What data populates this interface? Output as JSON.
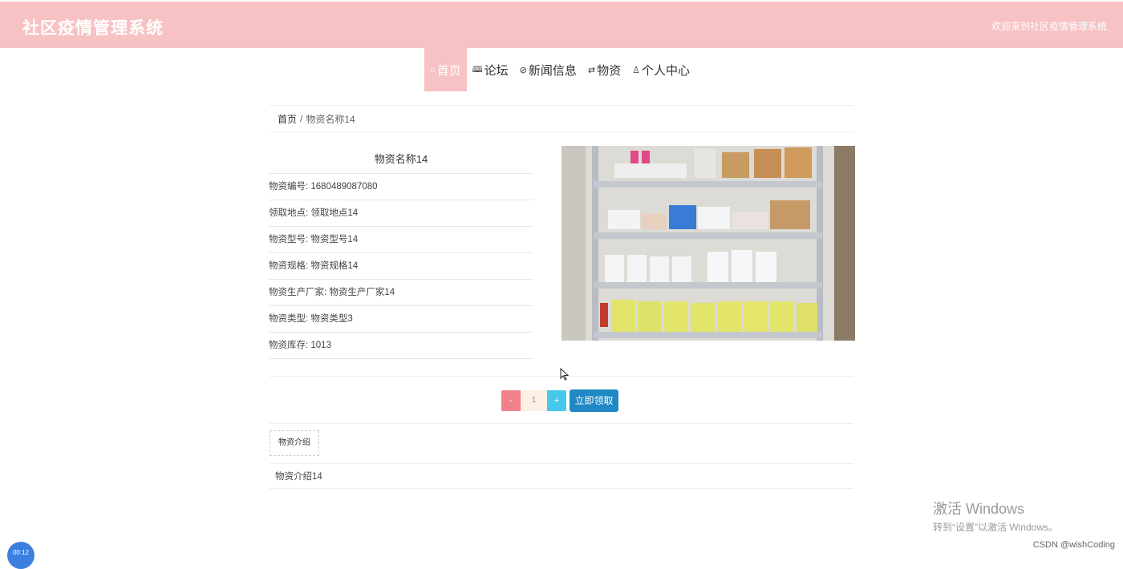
{
  "header": {
    "title": "社区疫情管理系统",
    "welcome": "欢迎来到社区疫情管理系统"
  },
  "nav": {
    "items": [
      {
        "label": "首页",
        "icon": "home-icon"
      },
      {
        "label": "论坛",
        "icon": "book-icon"
      },
      {
        "label": "新闻信息",
        "icon": "tag-icon"
      },
      {
        "label": "物资",
        "icon": "sliders-icon"
      },
      {
        "label": "个人中心",
        "icon": "user-icon"
      }
    ],
    "active_index": 0
  },
  "breadcrumb": {
    "home": "首页",
    "separator": "/",
    "current": "物资名称14"
  },
  "detail": {
    "name": "物资名称14",
    "rows": [
      "物资编号: 1680489087080",
      "领取地点: 领取地点14",
      "物资型号: 物资型号14",
      "物资规格: 物资规格14",
      "物资生产厂家: 物资生产厂家14",
      "物资类型: 物资类型3",
      "物资库存: 1013"
    ]
  },
  "quantity": {
    "minus": "-",
    "value": "1",
    "plus": "+",
    "submit": "立即领取"
  },
  "tabs": {
    "intro_tab": "物资介绍"
  },
  "description": "物资介绍14",
  "watermark": {
    "line1": "激活 Windows",
    "line2": "转到“设置”以激活 Windows。"
  },
  "csdn": "CSDN @wishCoding",
  "timer": "00:12",
  "colors": {
    "header_bg": "#f7c2c4",
    "submit_bg": "#1f88c5",
    "minus_bg": "#f0808a",
    "plus_bg": "#46c8ec"
  }
}
